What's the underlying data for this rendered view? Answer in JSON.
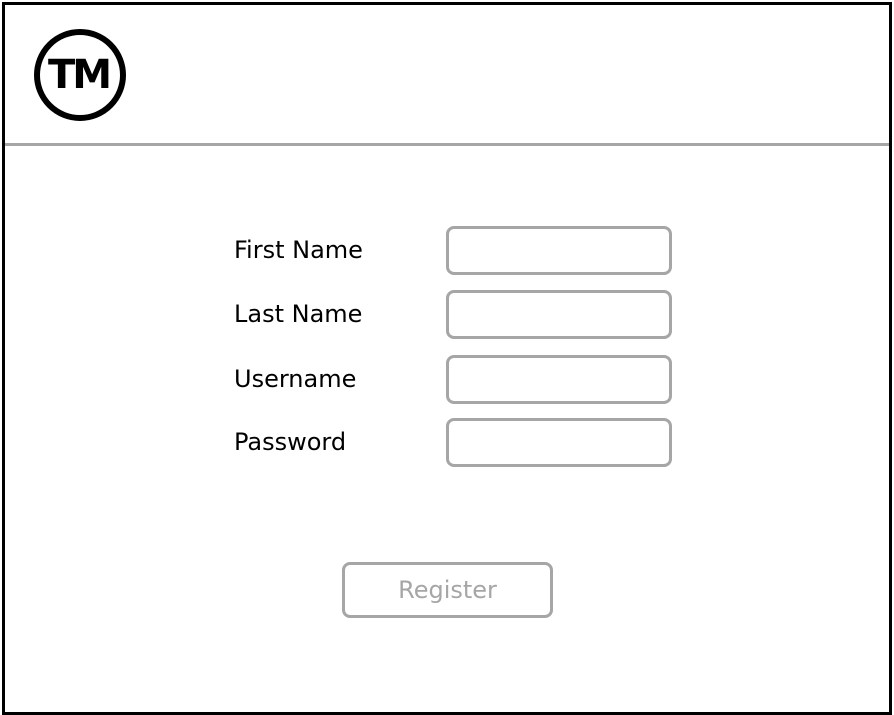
{
  "header": {
    "logo_text": "TM"
  },
  "form": {
    "fields": [
      {
        "label": "First Name",
        "value": "",
        "placeholder": ""
      },
      {
        "label": "Last Name",
        "value": "",
        "placeholder": ""
      },
      {
        "label": "Username",
        "value": "",
        "placeholder": ""
      },
      {
        "label": "Password",
        "value": "",
        "placeholder": ""
      }
    ],
    "register_label": "Register"
  },
  "colors": {
    "border": "#000000",
    "divider": "#a6a6a6",
    "input_border": "#a6a6a6",
    "button_text": "#a6a6a6"
  }
}
